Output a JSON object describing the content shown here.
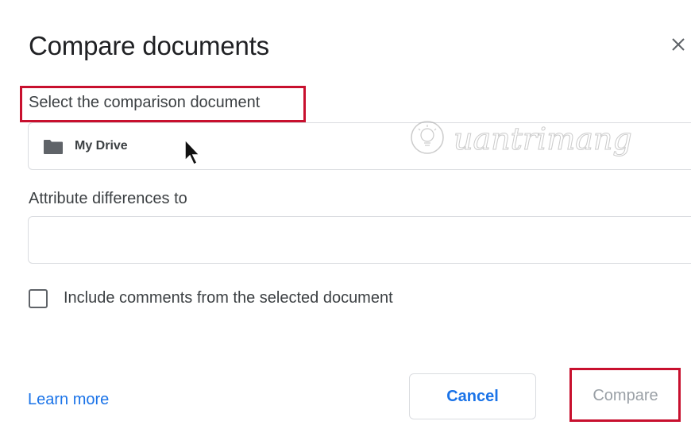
{
  "dialog": {
    "title": "Compare documents",
    "close_icon": "close-icon"
  },
  "select_document": {
    "label": "Select the comparison document",
    "folder_icon": "folder-icon",
    "value": "My Drive"
  },
  "attribute": {
    "label": "Attribute differences to",
    "value": ""
  },
  "include_comments": {
    "label": "Include comments from the selected document",
    "checked": false
  },
  "footer": {
    "learn_more": "Learn more",
    "cancel": "Cancel",
    "compare": "Compare"
  },
  "watermark": {
    "text": "uantrimang"
  },
  "colors": {
    "highlight": "#c8102e",
    "link": "#1a73e8",
    "disabled": "#9aa0a6"
  }
}
